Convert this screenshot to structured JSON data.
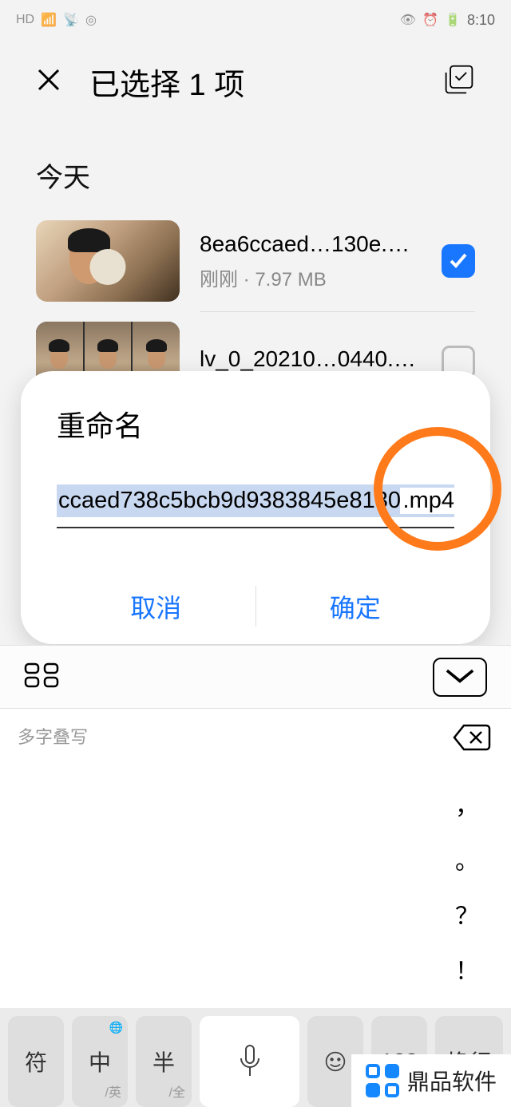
{
  "status": {
    "time": "8:10"
  },
  "header": {
    "title": "已选择 1 项"
  },
  "section": {
    "today": "今天"
  },
  "files": [
    {
      "name": "8ea6ccaed…130e.mp4",
      "meta": "刚刚 · 7.97 MB",
      "checked": true
    },
    {
      "name": "lv_0_20210…0440.mp4",
      "meta": "",
      "checked": false
    }
  ],
  "dialog": {
    "title": "重命名",
    "value": "ccaed738c5bcb9d9383845e8130e",
    "ext": ".mp4",
    "cancel": "取消",
    "confirm": "确定"
  },
  "keyboard": {
    "hint": "多字叠写",
    "symbols": [
      "，",
      "。",
      "？",
      "！"
    ],
    "keys": {
      "sym": "符",
      "lang": "中",
      "lang_sub": "/英",
      "width": "半",
      "width_sub": "/全",
      "num": "123",
      "enter": "换行"
    }
  },
  "watermark": "鼎品软件"
}
